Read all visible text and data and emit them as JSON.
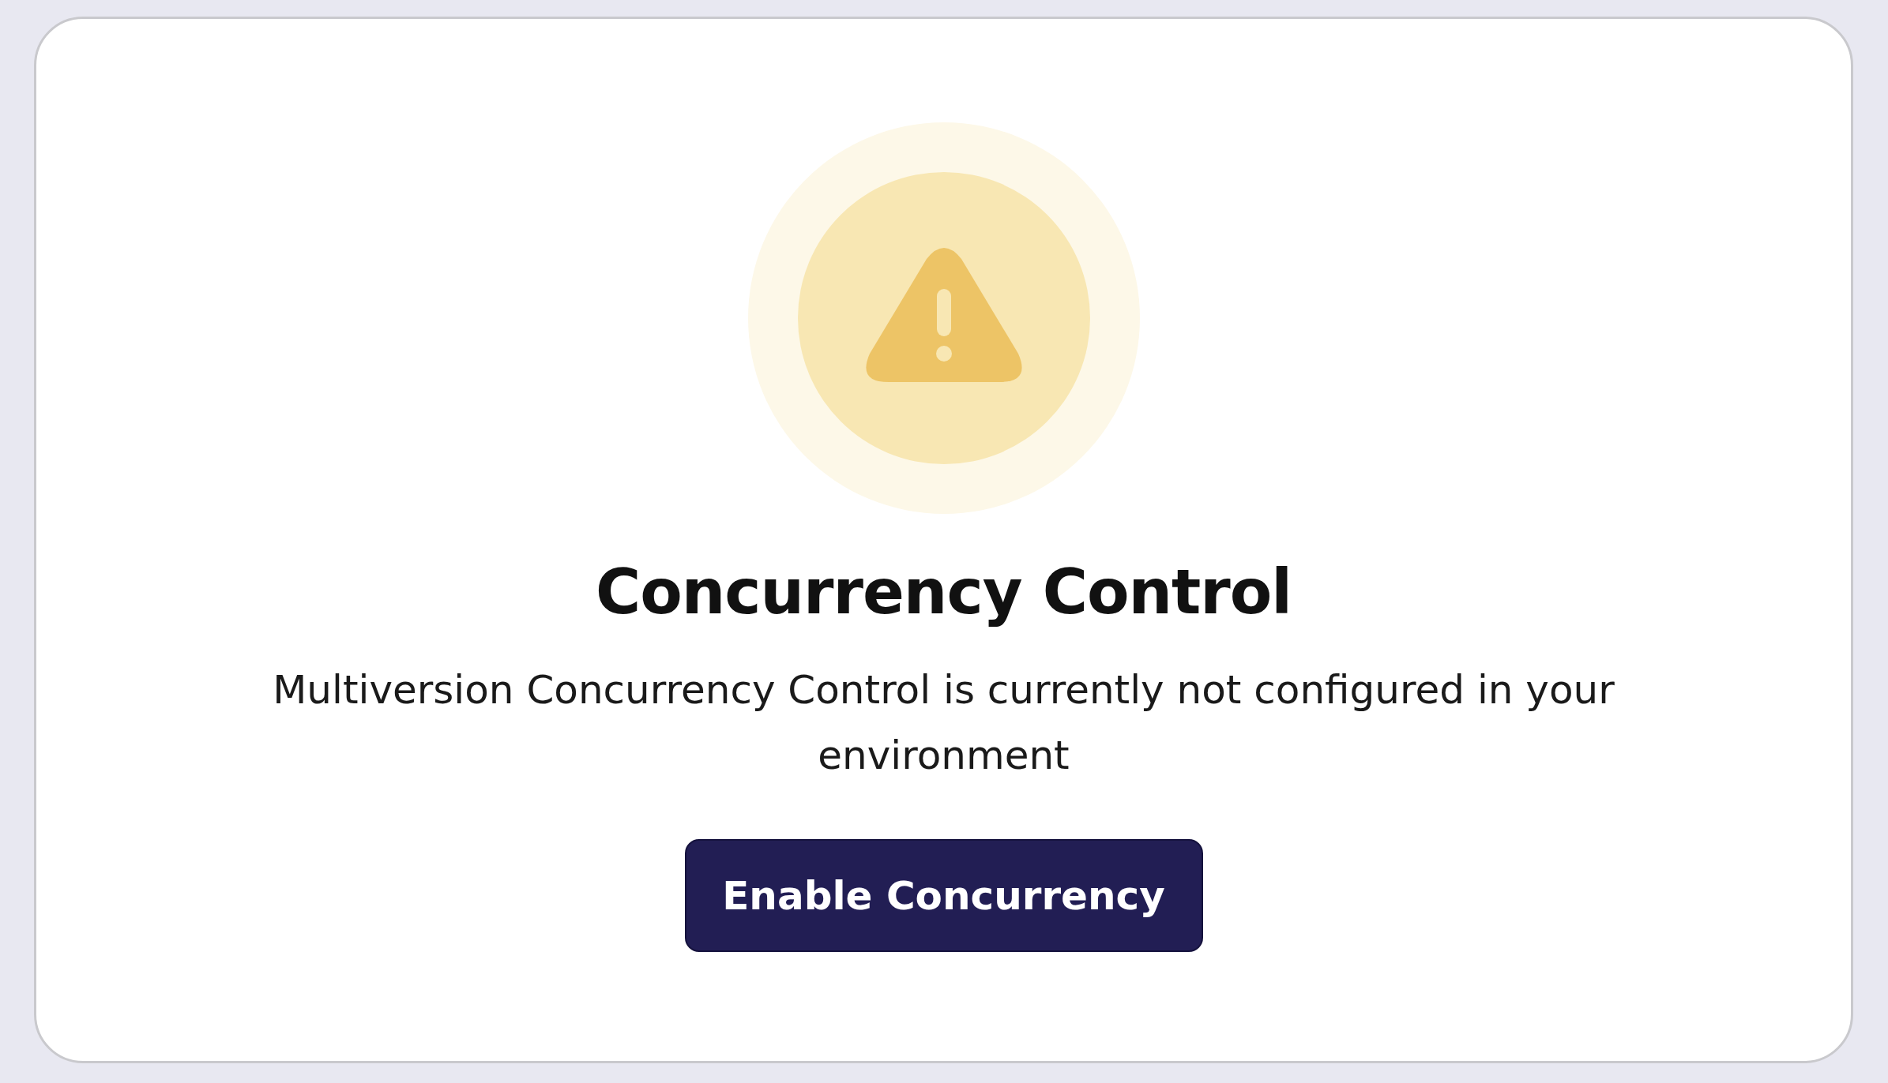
{
  "card": {
    "title": "Concurrency Control",
    "description": "Multiversion Concurrency Control is currently not configured in your environment",
    "button": "Enable Concurrency"
  }
}
